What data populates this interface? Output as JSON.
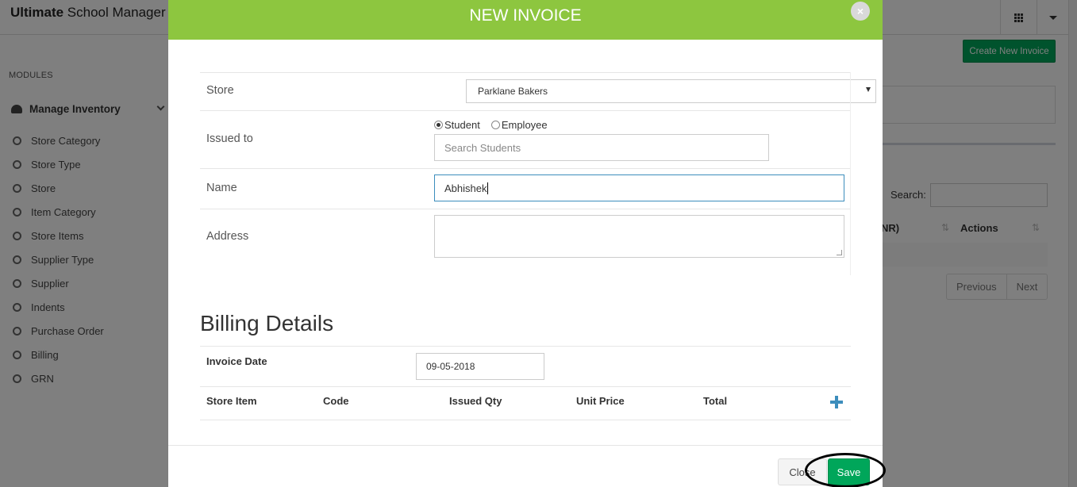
{
  "app": {
    "brand_bold": "Ultimate",
    "brand_rest": " School Manager"
  },
  "sidebar": {
    "modules_label": "MODULES",
    "section_title": "Manage Inventory",
    "items": [
      {
        "label": "Store Category"
      },
      {
        "label": "Store Type"
      },
      {
        "label": "Store"
      },
      {
        "label": "Item Category"
      },
      {
        "label": "Store Items"
      },
      {
        "label": "Supplier Type"
      },
      {
        "label": "Supplier"
      },
      {
        "label": "Indents"
      },
      {
        "label": "Purchase Order"
      },
      {
        "label": "Billing"
      },
      {
        "label": "GRN"
      }
    ]
  },
  "background": {
    "create_button": "Create New Invoice",
    "search_label": "Search:",
    "column_fragment": "NR)",
    "actions_header": "Actions",
    "prev_label": "Previous",
    "next_label": "Next"
  },
  "modal": {
    "title": "NEW INVOICE",
    "close_icon": "×",
    "store_label": "Store",
    "store_value": "Parklane Bakers",
    "issued_to_label": "Issued to",
    "radio_student": "Student",
    "radio_employee": "Employee",
    "selected_radio": "Student",
    "search_placeholder": "Search Students",
    "name_label": "Name",
    "name_value": "Abhishek",
    "address_label": "Address",
    "address_value": "",
    "billing_title": "Billing Details",
    "invoice_date_label": "Invoice Date",
    "invoice_date_value": "09-05-2018",
    "table_headers": [
      "Store Item",
      "Code",
      "Issued Qty",
      "Unit Price",
      "Total"
    ],
    "add_row_icon": "plus-icon",
    "close_button": "Close",
    "save_button": "Save"
  },
  "colors": {
    "header_green": "#8dc63f",
    "save_green": "#00a65a",
    "plus_blue": "#3c8dbc",
    "overlay": "rgba(0,0,0,0.5)"
  }
}
